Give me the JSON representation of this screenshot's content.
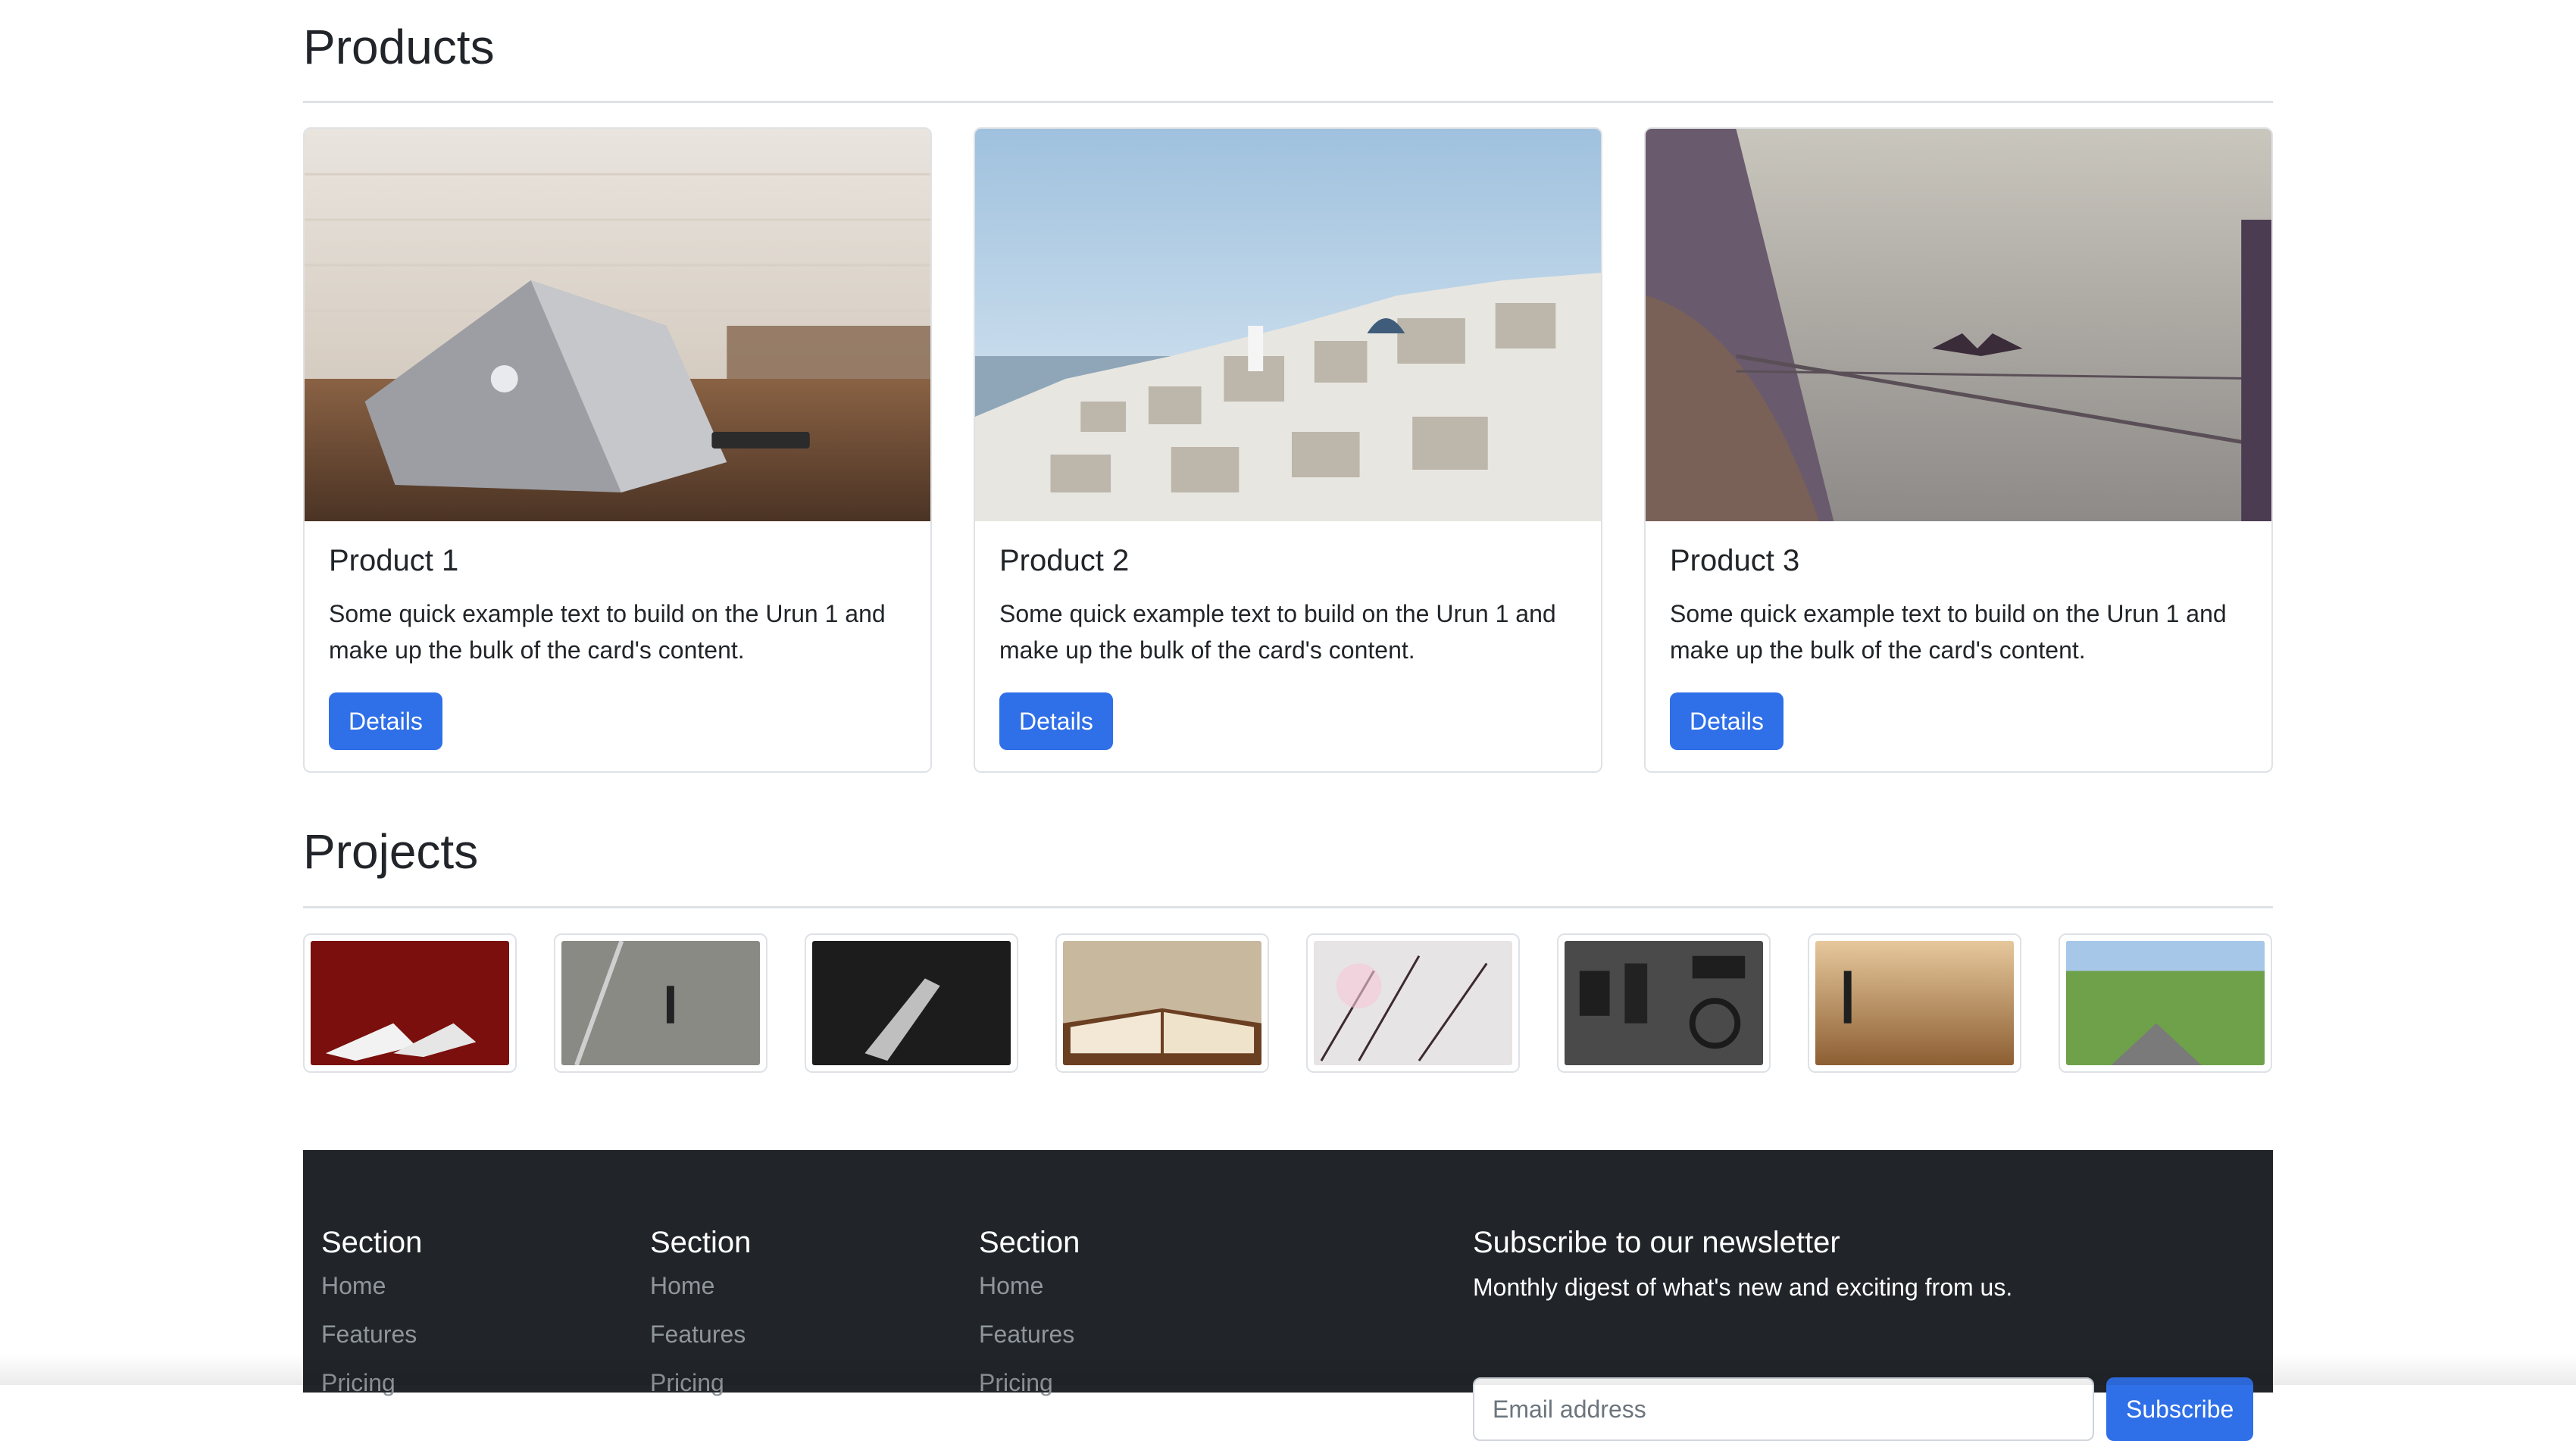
{
  "products": {
    "title": "Products",
    "items": [
      {
        "name": "Product 1",
        "text": "Some quick example text to build on the Urun 1 and make up the bulk of the card's content.",
        "button": "Details"
      },
      {
        "name": "Product 2",
        "text": "Some quick example text to build on the Urun 1 and make up the bulk of the card's content.",
        "button": "Details"
      },
      {
        "name": "Product 3",
        "text": "Some quick example text to build on the Urun 1 and make up the bulk of the card's content.",
        "button": "Details"
      }
    ]
  },
  "projects": {
    "title": "Projects"
  },
  "footer": {
    "sections": [
      {
        "title": "Section",
        "links": [
          "Home",
          "Features",
          "Pricing"
        ]
      },
      {
        "title": "Section",
        "links": [
          "Home",
          "Features",
          "Pricing"
        ]
      },
      {
        "title": "Section",
        "links": [
          "Home",
          "Features",
          "Pricing"
        ]
      }
    ],
    "newsletter": {
      "title": "Subscribe to our newsletter",
      "subtitle": "Monthly digest of what's new and exciting from us.",
      "placeholder": "Email address",
      "button": "Subscribe"
    }
  },
  "colors": {
    "accent": "#2f6fe8",
    "footer_bg": "#212529",
    "footer_link": "#8f969c"
  }
}
